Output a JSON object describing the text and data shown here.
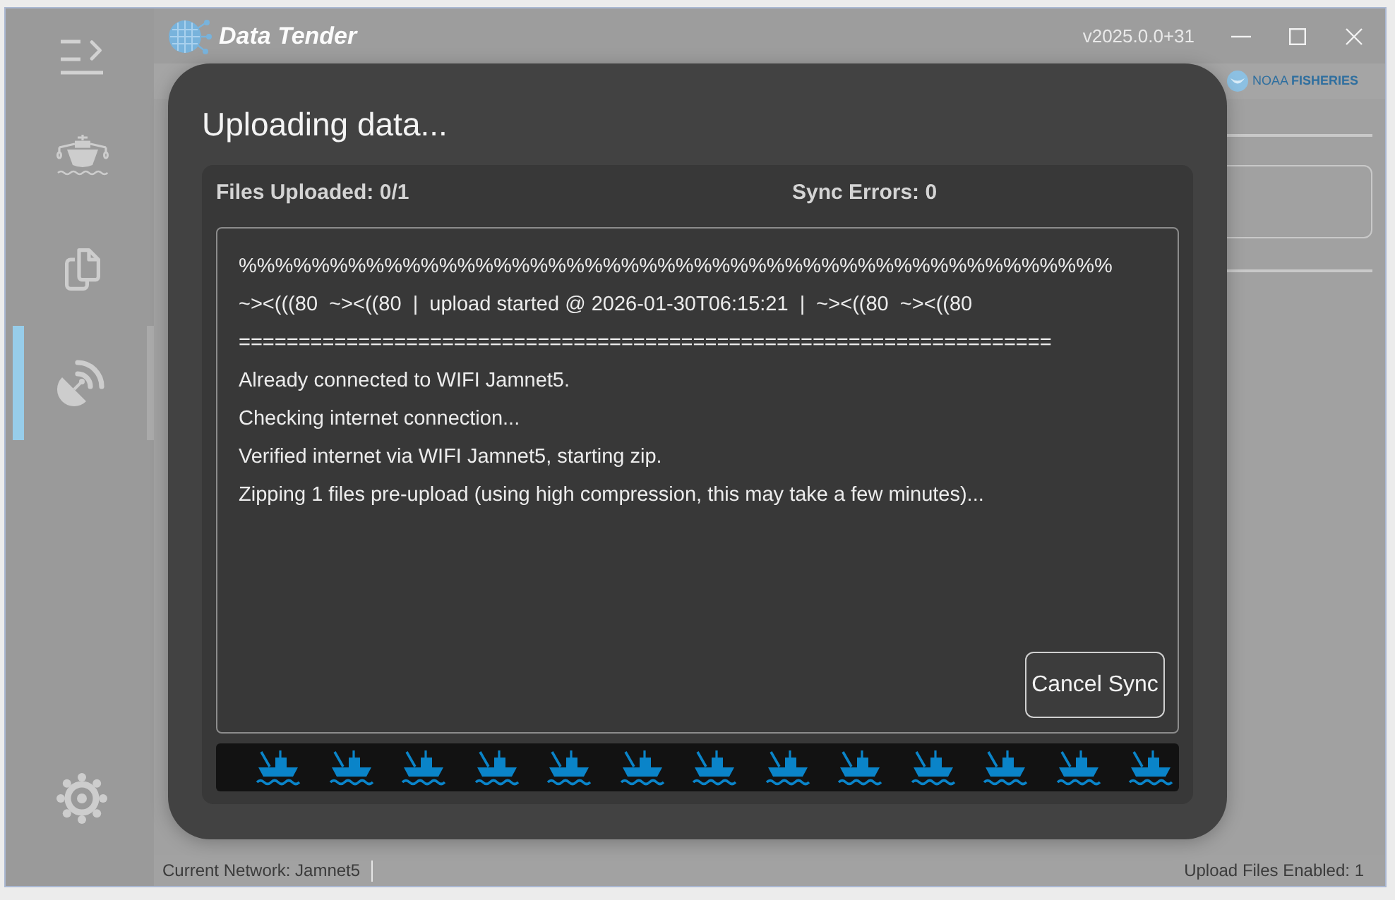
{
  "window": {
    "title": "Data Tender",
    "version": "v2025.0.0+31"
  },
  "header": {
    "logo_text": "NOAA **FISHERIES**"
  },
  "sidebar": {
    "items": [
      {
        "kind": "vessel",
        "selected": false
      },
      {
        "kind": "files",
        "selected": false
      },
      {
        "kind": "sync",
        "selected": true
      },
      {
        "kind": "settings",
        "selected": false
      }
    ]
  },
  "dialog": {
    "title": "Uploading data...",
    "files_uploaded": "Files Uploaded: 0/1",
    "sync_errors": "Sync Errors: 0",
    "log_lines": [
      "%%%%%%%%%%%%%%%%%%%%%%%%%%%%%%%%%%%%%%%%%%%%%%%%",
      "~><(((80  ~><((80  |  upload started @ 2026-01-30T06:15:21  |  ~><((80  ~><((80",
      "====================================================================",
      "Already connected to WIFI Jamnet5.",
      "Checking internet connection...",
      "Verified internet via WIFI Jamnet5, starting zip.",
      "Zipping 1 files pre-upload (using high compression, this may take a few minutes)..."
    ],
    "buttons": [
      "Cancel Sync"
    ]
  },
  "status_bar": {
    "network": "Current Network: Jamnet5",
    "upload_files": "Upload Files Enabled: 1"
  }
}
